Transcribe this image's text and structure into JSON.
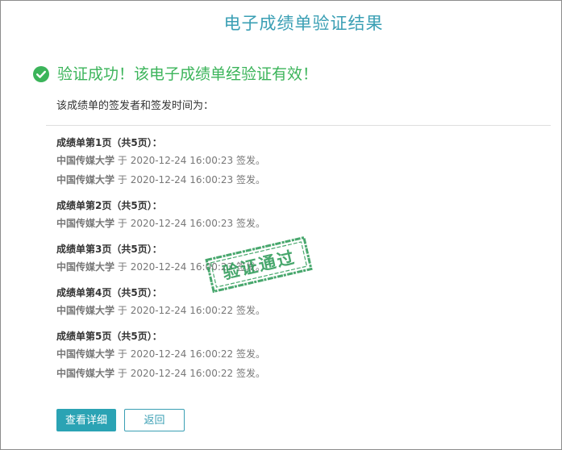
{
  "page": {
    "title": "电子成绩单验证结果"
  },
  "result": {
    "success_message": "验证成功！该电子成绩单经验证有效！",
    "signers_label": "该成绩单的签发者和签发时间为："
  },
  "pages": [
    {
      "heading": "成绩单第1页（共5页）：",
      "signatures": [
        {
          "org": "中国传媒大学",
          "prefix": "于",
          "time": "2020-12-24 16:00:23",
          "suffix": "签发。"
        },
        {
          "org": "中国传媒大学",
          "prefix": "于",
          "time": "2020-12-24 16:00:23",
          "suffix": "签发。"
        }
      ]
    },
    {
      "heading": "成绩单第2页（共5页）：",
      "signatures": [
        {
          "org": "中国传媒大学",
          "prefix": "于",
          "time": "2020-12-24 16:00:23",
          "suffix": "签发。"
        }
      ]
    },
    {
      "heading": "成绩单第3页（共5页）：",
      "signatures": [
        {
          "org": "中国传媒大学",
          "prefix": "于",
          "time": "2020-12-24 16:00:23",
          "suffix": "签发。"
        }
      ]
    },
    {
      "heading": "成绩单第4页（共5页）：",
      "signatures": [
        {
          "org": "中国传媒大学",
          "prefix": "于",
          "time": "2020-12-24 16:00:22",
          "suffix": "签发。"
        }
      ]
    },
    {
      "heading": "成绩单第5页（共5页）：",
      "signatures": [
        {
          "org": "中国传媒大学",
          "prefix": "于",
          "time": "2020-12-24 16:00:22",
          "suffix": "签发。"
        },
        {
          "org": "中国传媒大学",
          "prefix": "于",
          "time": "2020-12-24 16:00:22",
          "suffix": "签发。"
        }
      ]
    }
  ],
  "stamp": {
    "text": "验证通过"
  },
  "actions": {
    "detail_label": "查看详细",
    "back_label": "返回"
  },
  "icons": {
    "success": "check-circle-icon"
  },
  "colors": {
    "title": "#3a9fb4",
    "success": "#3bb45a",
    "primary_button": "#2ba3b4",
    "stamp": "#2f9c5a"
  }
}
